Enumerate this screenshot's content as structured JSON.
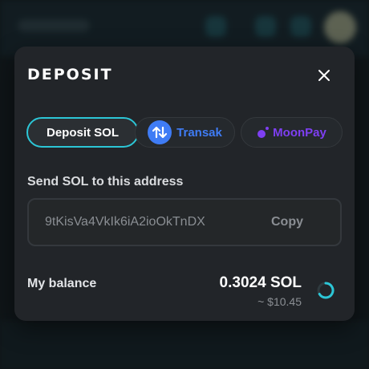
{
  "modal": {
    "title": "DEPOSIT",
    "tabs": [
      {
        "label": "Deposit SOL",
        "active": true
      },
      {
        "label": "Transak",
        "color": "#3f7cf5"
      },
      {
        "label": "MoonPay",
        "color": "#7e3ff2"
      }
    ],
    "address_label": "Send SOL to this address",
    "address": "9tKisVa4VkIk6iA2ioOkTnDX",
    "copy_label": "Copy",
    "balance": {
      "label": "My balance",
      "amount": "0.3024 SOL",
      "usd": "~ $10.45"
    }
  },
  "colors": {
    "accent": "#2cc6d6",
    "modal_bg": "#222529"
  },
  "icons": [
    "close-icon",
    "transak-icon",
    "moonpay-icon",
    "loading-spinner-icon"
  ]
}
